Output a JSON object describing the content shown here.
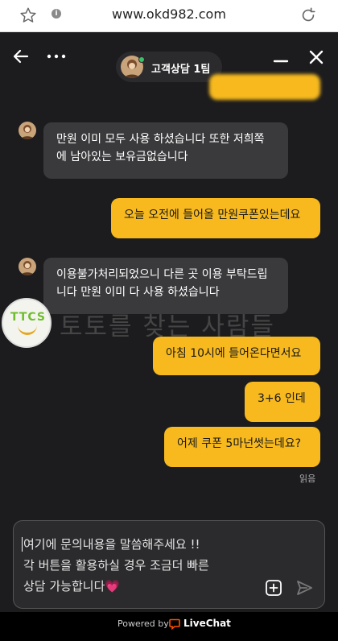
{
  "browser": {
    "url": "www.okd982.com"
  },
  "header": {
    "agent_name": "고객상담 1팀"
  },
  "messages": [
    {
      "from": "agent",
      "text": "만원 이미 모두 사용 하셨습니다 또한 저희쪽\n에 남아있는 보유금없습니다"
    },
    {
      "from": "user",
      "text": "오늘 오전에 들어올 만원쿠폰있는데요"
    },
    {
      "from": "agent",
      "text": "이용불가처리되었으니 다른 곳 이용 부탁드립\n니다 만원 이미 다 사용 하셨습니다"
    },
    {
      "from": "user",
      "text": "아침 10시에 들어온다면서요"
    },
    {
      "from": "user",
      "text": "3+6 인데"
    },
    {
      "from": "user",
      "text": "어제 쿠폰 5마넌썻는데요?"
    }
  ],
  "read_status": "읽음",
  "watermark": {
    "logo_text": "TTCS",
    "text": "토토를 찾는 사람들"
  },
  "composer": {
    "placeholder": "여기에 문의내용을 말씀해주세요 !!\n각 버튼을 활용하실 경우 조금더 빠른\n상담 가능합니다💗"
  },
  "footer": {
    "powered_by": "Powered by",
    "brand": "LiveChat"
  },
  "colors": {
    "accent": "#f7b91e",
    "agent_bubble": "#3a3a3c",
    "background": "#1c1c1e"
  }
}
